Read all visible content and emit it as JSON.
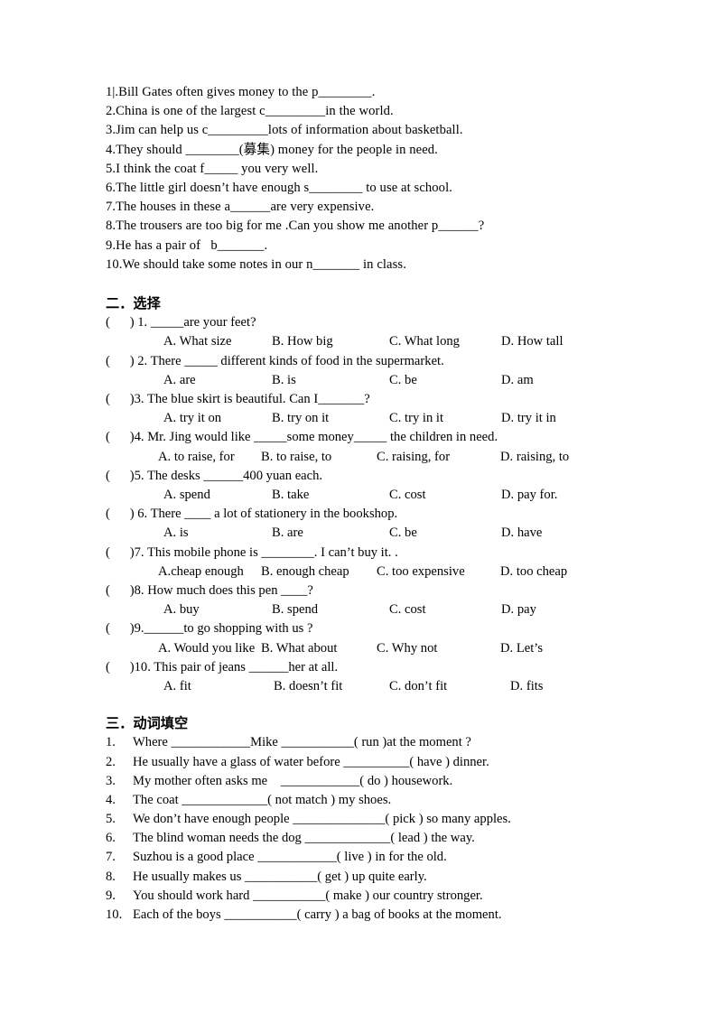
{
  "page": {
    "background": "#ffffff",
    "text_color": "#000000"
  },
  "section1": {
    "lines": [
      "1|.Bill Gates often gives money to the p________.",
      "2.China is one of the largest c_________in the world.",
      "3.Jim can help us c_________lots of information about basketball.",
      "4.They should ________(募集) money for the people in need.",
      "5.I think the coat f_____ you very well.",
      "6.The little girl doesn’t have enough s________ to use at school.",
      "7.The houses in these a______are very expensive.",
      "8.The trousers are too big for me .Can you show me another p______?",
      "9.He has a pair of   b_______.",
      "10.We should take some notes in our n_______ in class."
    ]
  },
  "section2": {
    "heading": "二．选择",
    "questions": [
      {
        "stem": "(      ) 1. _____are your feet?",
        "options": [
          "A. What size",
          "B. How big",
          "C. What long",
          "D. How tall"
        ]
      },
      {
        "stem": "(      ) 2. There _____ different kinds of food in the supermarket.",
        "options": [
          "A. are",
          "B. is",
          "C. be",
          "D. am"
        ]
      },
      {
        "stem": "(      )3. The blue skirt is beautiful. Can I_______?",
        "options": [
          "A. try it on",
          "B. try on it",
          "C. try in it",
          "D. try it in"
        ]
      },
      {
        "stem": "(      )4. Mr. Jing would like _____some money_____ the children in need.",
        "options": [
          "A. to raise, for",
          "B. to raise, to",
          "C. raising, for",
          "D. raising, to"
        ]
      },
      {
        "stem": "(      )5. The desks ______400 yuan each.",
        "options": [
          "A. spend",
          "B. take",
          "C. cost",
          "D. pay for."
        ]
      },
      {
        "stem": "(      ) 6. There ____ a lot of stationery in the bookshop.",
        "options": [
          "A. is",
          "B. are",
          "C. be",
          "D. have"
        ]
      },
      {
        "stem": "(      )7. This mobile phone is ________. I can’t buy it. .",
        "options": [
          "A.cheap enough",
          "B. enough cheap",
          "C. too expensive",
          "D. too cheap"
        ]
      },
      {
        "stem": "(      )8. How much does this pen ____?",
        "options": [
          "A. buy",
          "B. spend",
          "C. cost",
          "D. pay"
        ]
      },
      {
        "stem": "(      )9.______to go shopping with us ?",
        "options": [
          "A. Would you like",
          "B. What about",
          "C. Why not",
          "D. Let’s"
        ]
      },
      {
        "stem": "(      )10. This pair of jeans ______her at all.",
        "options": [
          "A. fit",
          "B. doesn’t fit",
          "C. don’t fit",
          "D. fits"
        ]
      }
    ]
  },
  "section3": {
    "heading": "三．动词填空",
    "items": [
      {
        "num": "1.",
        "text": "Where ____________Mike ___________( run )at the moment ?"
      },
      {
        "num": "2.",
        "text": "He usually have a glass of water before __________( have ) dinner."
      },
      {
        "num": "3.",
        "text": "My mother often asks me    ____________( do ) housework."
      },
      {
        "num": "4.",
        "text": "The coat _____________( not match ) my shoes."
      },
      {
        "num": "5.",
        "text": "We don’t have enough people ______________( pick ) so many apples."
      },
      {
        "num": "6.",
        "text": "The blind woman needs the dog _____________( lead ) the way."
      },
      {
        "num": "7.",
        "text": "Suzhou is a good place ____________( live ) in for the old."
      },
      {
        "num": "8.",
        "text": "He usually makes us ___________( get ) up quite early."
      },
      {
        "num": "9.",
        "text": "You should work hard ___________( make ) our country stronger."
      },
      {
        "num": "10.",
        "text": "Each of the boys ___________( carry ) a bag of books at the moment."
      }
    ]
  }
}
